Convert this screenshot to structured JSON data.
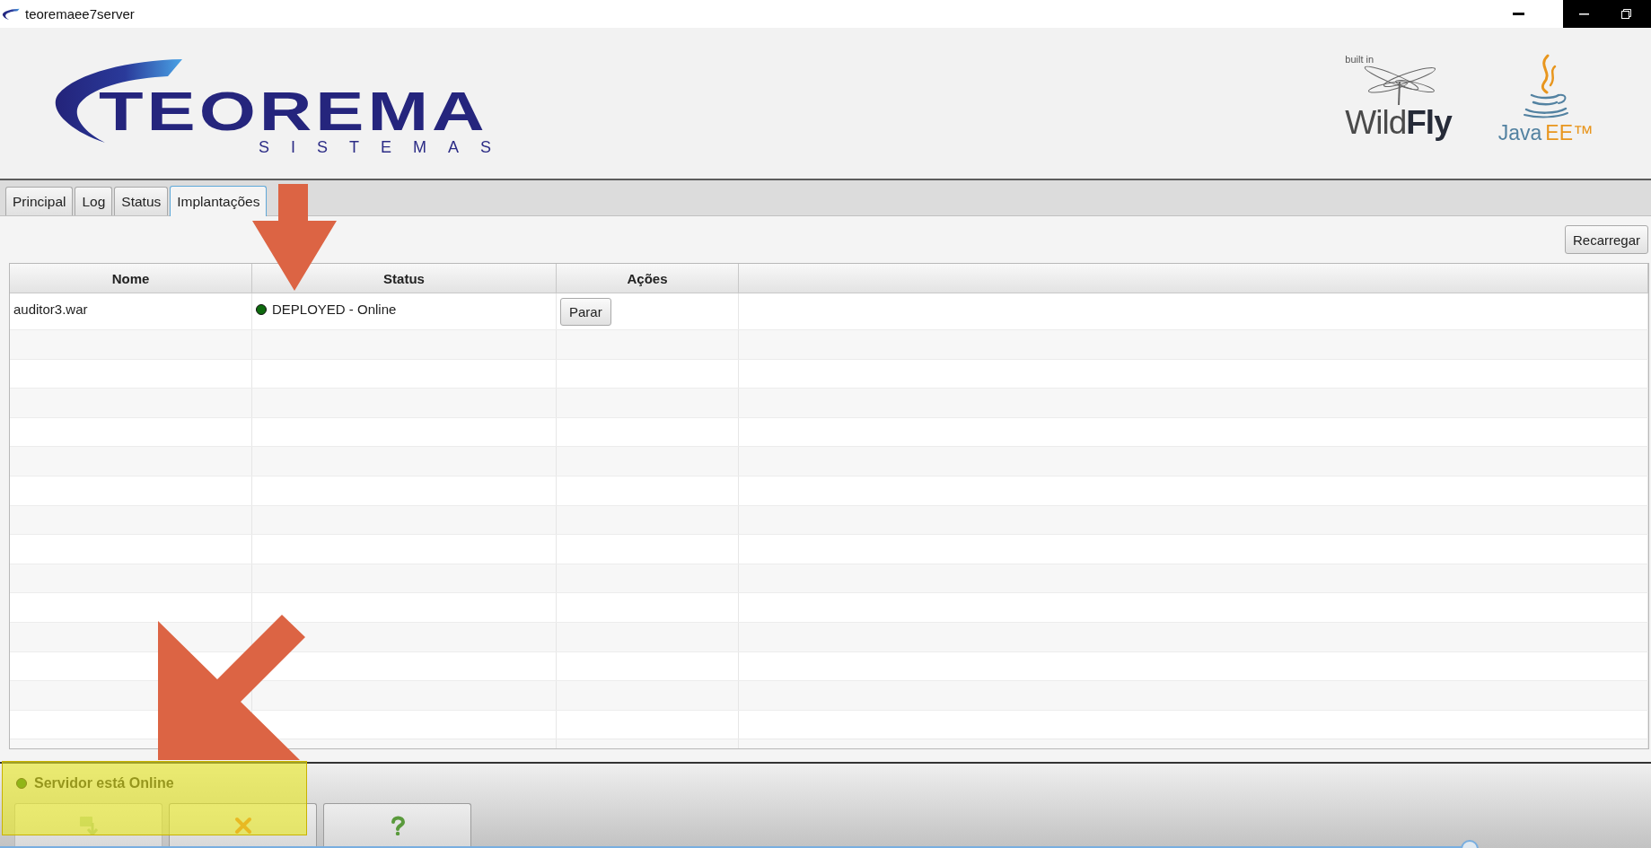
{
  "window": {
    "title": "teoremaee7server"
  },
  "header": {
    "brand": {
      "name": "TEOREMA",
      "tagline": "SISTEMAS"
    },
    "wildfly": {
      "caption": "built in",
      "name": "Wild**Fly**"
    },
    "java_ee": {
      "java": "Java",
      "ee": "EE™"
    }
  },
  "tabs": [
    {
      "label": "Principal",
      "selected": false
    },
    {
      "label": "Log",
      "selected": false
    },
    {
      "label": "Status",
      "selected": false
    },
    {
      "label": "Implantações",
      "selected": true
    }
  ],
  "toolbar": {
    "reload": "Recarregar"
  },
  "table": {
    "columns": [
      "Nome",
      "Status",
      "Ações"
    ],
    "rows": [
      {
        "name": "auditor3.war",
        "online": true,
        "status": "DEPLOYED - Online",
        "action": "Parar"
      }
    ]
  },
  "status_bar": {
    "online": true,
    "text": "Servidor está Online",
    "buttons": [
      {
        "disabled": true
      },
      {
        "disabled": false
      },
      {
        "disabled": false
      }
    ]
  },
  "overlays": [
    {
      "kind": "arrow-down"
    },
    {
      "kind": "arrow-down-left"
    },
    {
      "kind": "highlight"
    }
  ],
  "video_progress": {
    "level": 0.89
  }
}
